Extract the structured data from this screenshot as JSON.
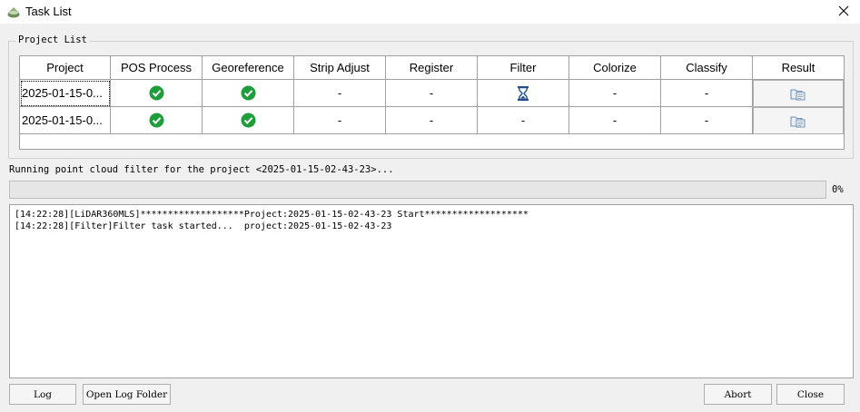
{
  "window": {
    "title": "Task List",
    "app_icon": "app-logo-icon",
    "close_icon": "close-icon"
  },
  "project_list": {
    "legend": "Project List",
    "columns": [
      "Project",
      "POS Process",
      "Georeference",
      "Strip Adjust",
      "Register",
      "Filter",
      "Colorize",
      "Classify",
      "Result"
    ],
    "rows": [
      {
        "project": "2025-01-15-0...",
        "pos_process": "done",
        "georeference": "done",
        "strip_adjust": "-",
        "register": "-",
        "filter": "running",
        "colorize": "-",
        "classify": "-",
        "result": "folder-icon"
      },
      {
        "project": "2025-01-15-0...",
        "pos_process": "done",
        "georeference": "done",
        "strip_adjust": "-",
        "register": "-",
        "filter": "-",
        "colorize": "-",
        "classify": "-",
        "result": "folder-icon"
      }
    ]
  },
  "status": {
    "message": "Running point cloud filter for the project <2025-01-15-02-43-23>...",
    "progress": 0,
    "progress_label": "0%"
  },
  "log": {
    "lines": [
      "[14:22:28][LiDAR360MLS]*******************Project:2025-01-15-02-43-23 Start*******************",
      "[14:22:28][Filter]Filter task started...  project:2025-01-15-02-43-23"
    ]
  },
  "buttons": {
    "log": "Log",
    "open_log_folder": "Open Log Folder",
    "abort": "Abort",
    "close": "Close"
  },
  "colors": {
    "check_green": "#1e9e3a",
    "hourglass_blue": "#1f4e8c",
    "folder_blue": "#6f8fb5"
  }
}
